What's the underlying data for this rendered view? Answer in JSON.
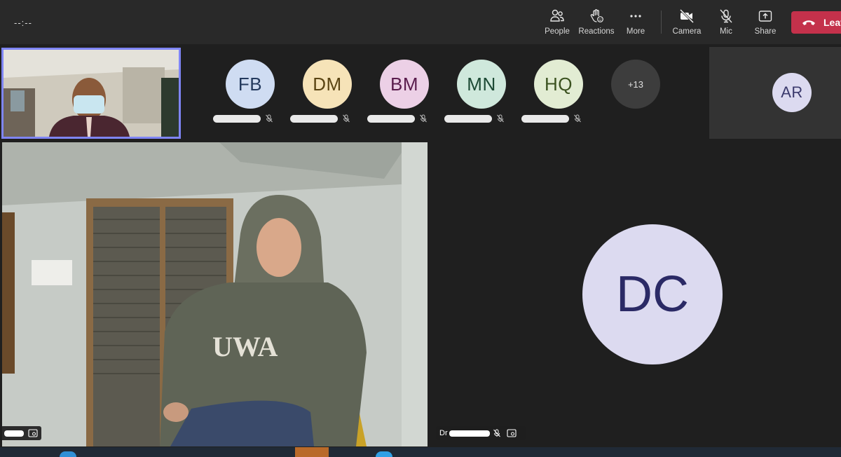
{
  "toolbar": {
    "timer": "--:--",
    "buttons": [
      {
        "id": "people",
        "label": "People",
        "icon": "people-icon"
      },
      {
        "id": "reactions",
        "label": "Reactions",
        "icon": "raise-hand-icon"
      },
      {
        "id": "more",
        "label": "More",
        "icon": "more-icon"
      },
      {
        "id": "camera",
        "label": "Camera",
        "icon": "camera-off-icon"
      },
      {
        "id": "mic",
        "label": "Mic",
        "icon": "mic-off-icon"
      },
      {
        "id": "share",
        "label": "Share",
        "icon": "share-icon"
      }
    ],
    "leave_label": "Leave",
    "leave_color": "#c4314b"
  },
  "participants": [
    {
      "initials": "FB",
      "bg": "#cfdcf2",
      "fg": "#243a5e"
    },
    {
      "initials": "DM",
      "bg": "#f6e3b8",
      "fg": "#5a4413"
    },
    {
      "initials": "BM",
      "bg": "#ecd0e6",
      "fg": "#5a1d4d"
    },
    {
      "initials": "MN",
      "bg": "#cfe8dc",
      "fg": "#1d4a35"
    },
    {
      "initials": "HQ",
      "bg": "#e2ecd3",
      "fg": "#3b5220"
    }
  ],
  "overflow_count": "+13",
  "tile_ar": {
    "initials": "AR"
  },
  "tile_dc": {
    "initials": "DC",
    "name_prefix": "Dr"
  },
  "main_video": {
    "hoodie_text": "UWA"
  },
  "accent_color": "#7f85f5"
}
